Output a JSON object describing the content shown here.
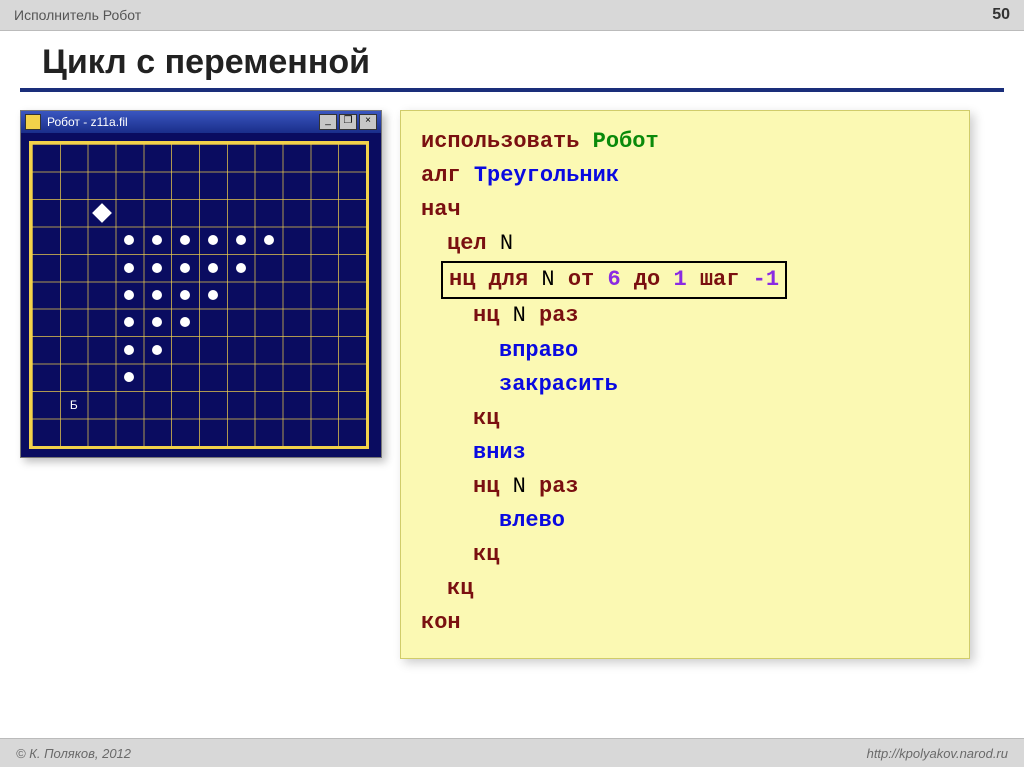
{
  "header": {
    "breadcrumb": "Исполнитель Робот",
    "page_number": "50"
  },
  "title": "Цикл с переменной",
  "robot_window": {
    "title": "Робот - z11a.fil",
    "buttons": {
      "minimize": "_",
      "maximize": "❐",
      "close": "×"
    },
    "grid": {
      "cols": 12,
      "rows": 11
    },
    "robot_pos": {
      "col": 2,
      "row": 2
    },
    "base_label": "Б",
    "base_pos": {
      "col": 1,
      "row": 9
    },
    "dots": [
      {
        "col": 3,
        "row": 3
      },
      {
        "col": 4,
        "row": 3
      },
      {
        "col": 5,
        "row": 3
      },
      {
        "col": 6,
        "row": 3
      },
      {
        "col": 7,
        "row": 3
      },
      {
        "col": 8,
        "row": 3
      },
      {
        "col": 3,
        "row": 4
      },
      {
        "col": 4,
        "row": 4
      },
      {
        "col": 5,
        "row": 4
      },
      {
        "col": 6,
        "row": 4
      },
      {
        "col": 7,
        "row": 4
      },
      {
        "col": 3,
        "row": 5
      },
      {
        "col": 4,
        "row": 5
      },
      {
        "col": 5,
        "row": 5
      },
      {
        "col": 6,
        "row": 5
      },
      {
        "col": 3,
        "row": 6
      },
      {
        "col": 4,
        "row": 6
      },
      {
        "col": 5,
        "row": 6
      },
      {
        "col": 3,
        "row": 7
      },
      {
        "col": 4,
        "row": 7
      },
      {
        "col": 3,
        "row": 8
      }
    ]
  },
  "code": {
    "use_kw": "использовать",
    "use_target": "Робот",
    "alg_kw": "алг",
    "alg_name": "Треугольник",
    "begin_kw": "нач",
    "decl_kw": "цел",
    "decl_var": "N",
    "for_prefix": "нц для",
    "for_var": "N",
    "for_from_kw": "от",
    "for_from_val": "6",
    "for_to_kw": "до",
    "for_to_val": "1",
    "for_step_kw": "шаг",
    "for_step_val": "-1",
    "inner_loop": "нц",
    "inner_count": "N",
    "inner_times": "раз",
    "cmd_right": "вправо",
    "cmd_paint": "закрасить",
    "loop_end": "кц",
    "cmd_down": "вниз",
    "cmd_left": "влево",
    "end_kw": "кон"
  },
  "footer": {
    "copyright": "© К. Поляков, 2012",
    "url": "http://kpolyakov.narod.ru"
  }
}
